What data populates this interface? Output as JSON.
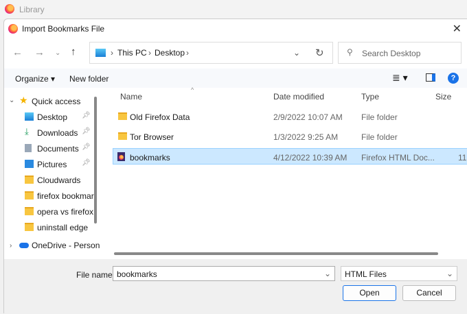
{
  "background_window": {
    "title": "Library"
  },
  "dialog": {
    "title": "Import Bookmarks File"
  },
  "address": {
    "crumbs": [
      "This PC",
      "Desktop"
    ]
  },
  "search": {
    "placeholder": "Search Desktop"
  },
  "toolbar": {
    "organize": "Organize ▾",
    "new_folder": "New folder",
    "help": "?"
  },
  "sidebar": {
    "quick_access": "Quick access",
    "items": [
      {
        "label": "Desktop",
        "icon": "desktop-icon",
        "pinned": true
      },
      {
        "label": "Downloads",
        "icon": "download-icon",
        "pinned": true
      },
      {
        "label": "Documents",
        "icon": "documents-icon",
        "pinned": true
      },
      {
        "label": "Pictures",
        "icon": "pictures-icon",
        "pinned": true
      },
      {
        "label": "Cloudwards",
        "icon": "folder-icon",
        "pinned": false
      },
      {
        "label": "firefox bookmar",
        "icon": "folder-icon",
        "pinned": false
      },
      {
        "label": "opera vs firefox",
        "icon": "folder-icon",
        "pinned": false
      },
      {
        "label": "uninstall edge",
        "icon": "folder-icon",
        "pinned": false
      }
    ],
    "onedrive": "OneDrive - Person"
  },
  "columns": [
    "Name",
    "Date modified",
    "Type",
    "Size"
  ],
  "files": [
    {
      "name": "Old Firefox Data",
      "date": "2/9/2022 10:07 AM",
      "type": "File folder",
      "size": "",
      "icon": "folder-icon"
    },
    {
      "name": "Tor Browser",
      "date": "1/3/2022 9:25 AM",
      "type": "File folder",
      "size": "",
      "icon": "folder-icon"
    },
    {
      "name": "bookmarks",
      "date": "4/12/2022 10:39 AM",
      "type": "Firefox HTML Doc...",
      "size": "11",
      "icon": "firefox-html-icon",
      "selected": true
    }
  ],
  "bottom": {
    "file_name_label": "File name:",
    "file_name": "bookmarks",
    "filter": "HTML Files",
    "open": "Open",
    "cancel": "Cancel"
  }
}
